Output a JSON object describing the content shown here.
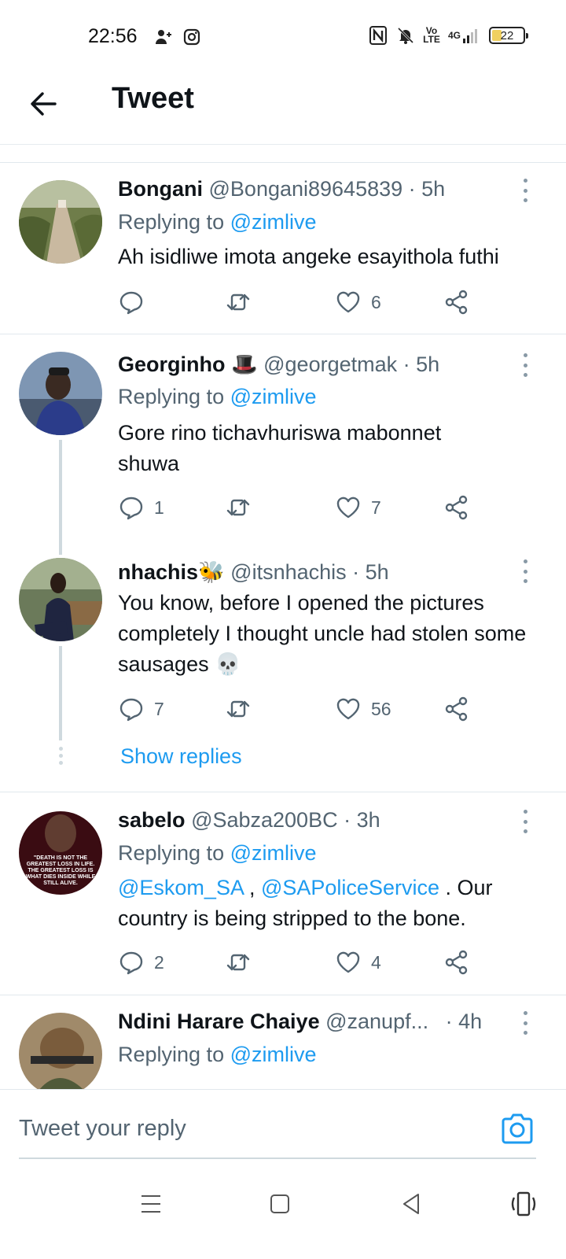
{
  "status_bar": {
    "time": "22:56",
    "battery": "22",
    "network": "4G",
    "volte": "Vo LTE"
  },
  "header": {
    "title": "Tweet"
  },
  "tweets": [
    {
      "name": "Bongani",
      "handle": "@Bongani89645839",
      "time": "· 5h",
      "replying_prefix": "Replying to ",
      "replying_to": "@zimlive",
      "text": "Ah isidliwe imota angeke esayithola futhi",
      "replies": "",
      "retweets": "",
      "likes": "6"
    },
    {
      "name": "Georginho 🎩",
      "handle": "@georgetmak",
      "time": "· 5h",
      "replying_prefix": "Replying to ",
      "replying_to": "@zimlive",
      "text": "Gore rino tichavhuriswa mabonnet shuwa",
      "replies": "1",
      "retweets": "",
      "likes": "7"
    },
    {
      "name": "nhachis🐝",
      "handle": "@itsnhachis",
      "time": "· 5h",
      "text": "You know, before I opened the pictures completely I thought uncle had stolen some sausages 💀",
      "replies": "7",
      "retweets": "",
      "likes": "56",
      "show_replies": "Show replies"
    },
    {
      "name": "sabelo",
      "handle": "@Sabza200BC",
      "time": "· 3h",
      "replying_prefix": "Replying to ",
      "replying_to": "@zimlive",
      "mention_1": "@Eskom_SA",
      "mention_sep": " , ",
      "mention_2": "@SAPoliceService",
      "text_after": " . Our country is being stripped to the bone.",
      "replies": "2",
      "retweets": "",
      "likes": "4",
      "avatar_text": "\"DEATH IS NOT THE GREATEST LOSS IN LIFE. THE GREATEST LOSS IS WHAT DIES INSIDE WHILE STILL ALIVE."
    },
    {
      "name": "Ndini Harare Chaiye",
      "handle": "@zanupf...",
      "time": "· 4h",
      "replying_prefix": "Replying to ",
      "replying_to": "@zimlive"
    }
  ],
  "reply_box": {
    "placeholder": "Tweet your reply"
  },
  "colors": {
    "accent": "#1d9bf0",
    "text_primary": "#0f1419",
    "text_secondary": "#536471"
  }
}
